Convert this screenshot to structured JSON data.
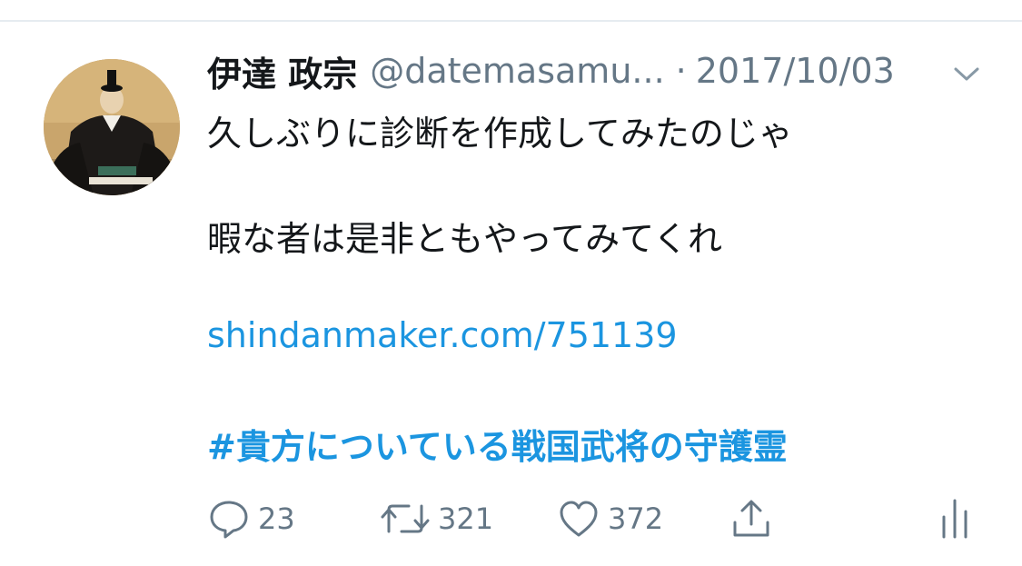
{
  "tweet": {
    "display_name": "伊達 政宗",
    "handle": "@datemasamu...",
    "separator": "·",
    "date": "2017/10/03",
    "text_line1": "久しぶりに診断を作成してみたのじゃ",
    "text_line2": "暇な者は是非ともやってみてくれ",
    "link": "shindanmaker.com/751139",
    "hashtag": "#貴方についている戦国武将の守護霊"
  },
  "actions": {
    "reply_count": "23",
    "retweet_count": "321",
    "like_count": "372"
  },
  "icons": {
    "menu": "chevron-down-icon",
    "reply": "reply-icon",
    "retweet": "retweet-icon",
    "like": "heart-icon",
    "share": "share-icon",
    "analytics": "analytics-icon"
  },
  "colors": {
    "text": "#14171a",
    "secondary": "#657786",
    "link": "#1b95e0",
    "divider": "#e6ecf0"
  }
}
